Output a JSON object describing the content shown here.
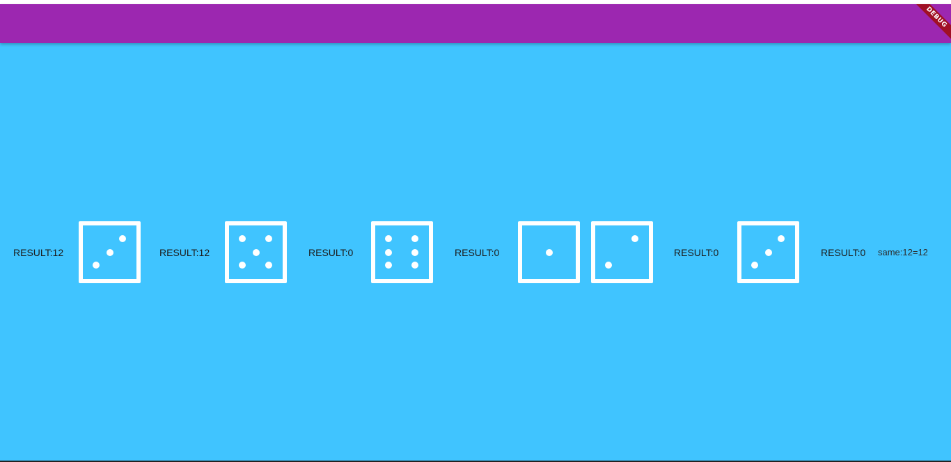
{
  "app_bar": {
    "banner_label": "DEBUG"
  },
  "row": {
    "result_1": "RESULT:12",
    "result_2": "RESULT:12",
    "result_3": "RESULT:0",
    "result_4": "RESULT:0",
    "result_5": "RESULT:0",
    "result_6": "RESULT:0",
    "same_text": "same:12=12"
  },
  "dice": [
    {
      "value": 3
    },
    {
      "value": 5
    },
    {
      "value": 6
    },
    {
      "value": 1
    },
    {
      "value": 2
    },
    {
      "value": 3
    }
  ],
  "colors": {
    "app_bar": "#9c27b0",
    "background": "#40c4ff",
    "die": "#ffffff",
    "debug_banner": "#a01025"
  }
}
